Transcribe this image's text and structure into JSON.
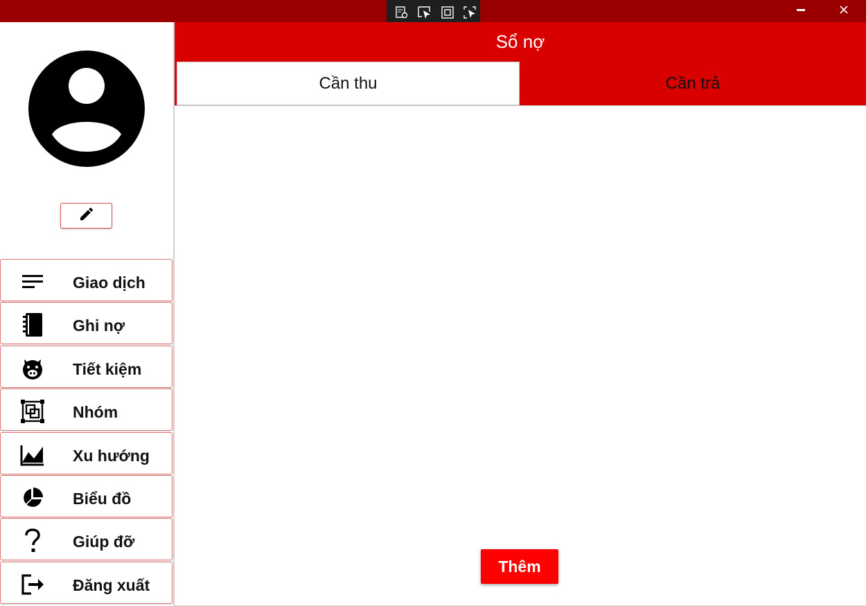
{
  "window": {
    "minimize_icon": "minimize-icon",
    "close_icon": "close-icon",
    "title_bar_color": "#9b0000"
  },
  "debug_toolbar": {
    "icons": [
      "live-visual-tree-icon",
      "select-element-icon",
      "display-layout-adorners-icon",
      "track-focused-element-icon"
    ]
  },
  "sidebar": {
    "avatar_icon": "account-circle-icon",
    "edit_icon": "pencil-icon",
    "items": [
      {
        "label": "Giao dịch",
        "icon": "list-lines-icon"
      },
      {
        "label": "Ghi nợ",
        "icon": "notebook-icon"
      },
      {
        "label": "Tiết kiệm",
        "icon": "piggy-bank-icon"
      },
      {
        "label": "Nhóm",
        "icon": "group-icon"
      },
      {
        "label": "Xu hướng",
        "icon": "trend-chart-icon"
      },
      {
        "label": "Biểu đồ",
        "icon": "pie-chart-icon"
      },
      {
        "label": "Giúp đỡ",
        "icon": "question-icon"
      },
      {
        "label": "Đăng xuất",
        "icon": "logout-icon"
      }
    ]
  },
  "main": {
    "title": "Sổ nợ",
    "tabs": [
      {
        "label": "Cần thu",
        "selected": true
      },
      {
        "label": "Cần trả",
        "selected": false
      }
    ],
    "add_button_label": "Thêm"
  },
  "colors": {
    "accent": "#d90000",
    "button": "#ff0000",
    "border": "#e57373"
  }
}
